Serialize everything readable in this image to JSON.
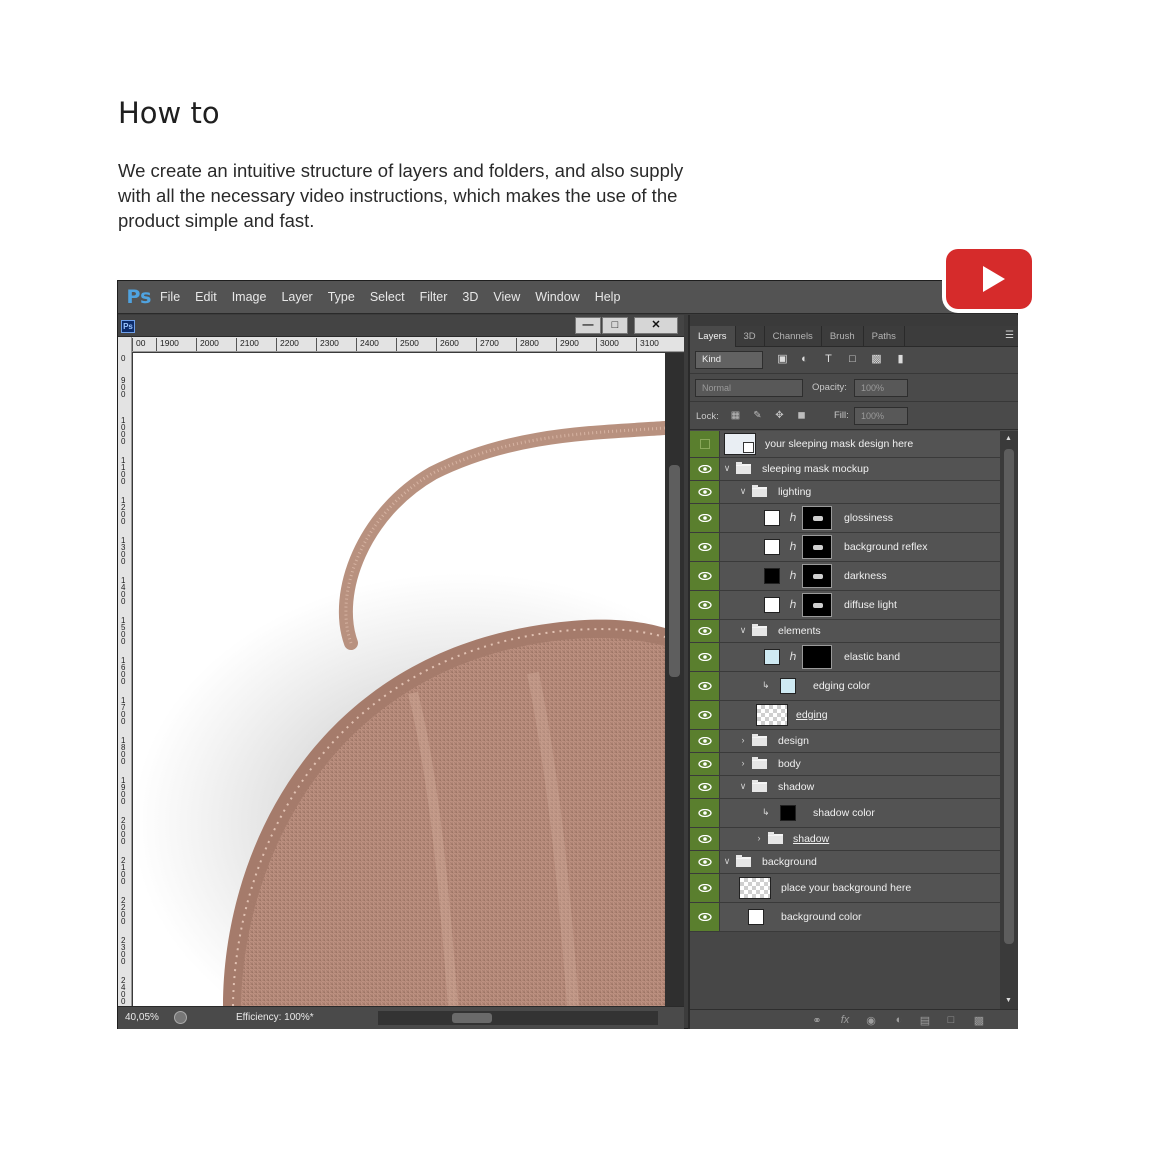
{
  "heading": "How to",
  "description": "We create an intuitive structure of layers and folders, and also supply with all the necessary video instructions, which makes the use of the product simple and fast.",
  "play_button": {
    "color": "#d62b2b",
    "icon": "play-icon"
  },
  "photoshop": {
    "logo": "Ps",
    "menu": [
      "File",
      "Edit",
      "Image",
      "Layer",
      "Type",
      "Select",
      "Filter",
      "3D",
      "View",
      "Window",
      "Help"
    ],
    "document": {
      "doc_icon": "Ps",
      "window_buttons": {
        "minimize": "—",
        "restore": "□",
        "close": "✕"
      },
      "ruler_top": [
        "00",
        "1900",
        "2000",
        "2100",
        "2200",
        "2300",
        "2400",
        "2500",
        "2600",
        "2700",
        "2800",
        "2900",
        "3000",
        "3100"
      ],
      "ruler_left": [
        "0",
        "900",
        "1000",
        "1100",
        "1200",
        "1300",
        "1400",
        "1500",
        "1600",
        "1700",
        "1800",
        "1900",
        "2000",
        "2100",
        "2200",
        "2300",
        "2400"
      ],
      "zoom": "40,05%",
      "efficiency": "Efficiency: 100%*"
    },
    "panel": {
      "tabs": [
        "Layers",
        "3D",
        "Channels",
        "Brush",
        "Paths"
      ],
      "filter_kind": "Kind",
      "blend_mode": "Normal",
      "opacity_label": "Opacity:",
      "opacity_value": "100%",
      "lock_label": "Lock:",
      "fill_label": "Fill:",
      "fill_value": "100%",
      "layers": [
        {
          "name": "your sleeping mask design here"
        },
        {
          "name": "sleeping mask mockup"
        },
        {
          "name": "lighting"
        },
        {
          "name": "glossiness"
        },
        {
          "name": "background reflex"
        },
        {
          "name": "darkness"
        },
        {
          "name": "diffuse light"
        },
        {
          "name": "elements"
        },
        {
          "name": "elastic band"
        },
        {
          "name": "edging color"
        },
        {
          "name": "edging"
        },
        {
          "name": "design"
        },
        {
          "name": "body"
        },
        {
          "name": "shadow"
        },
        {
          "name": "shadow color"
        },
        {
          "name": "shadow"
        },
        {
          "name": "background"
        },
        {
          "name": "place your background here"
        },
        {
          "name": "background color"
        }
      ]
    }
  }
}
